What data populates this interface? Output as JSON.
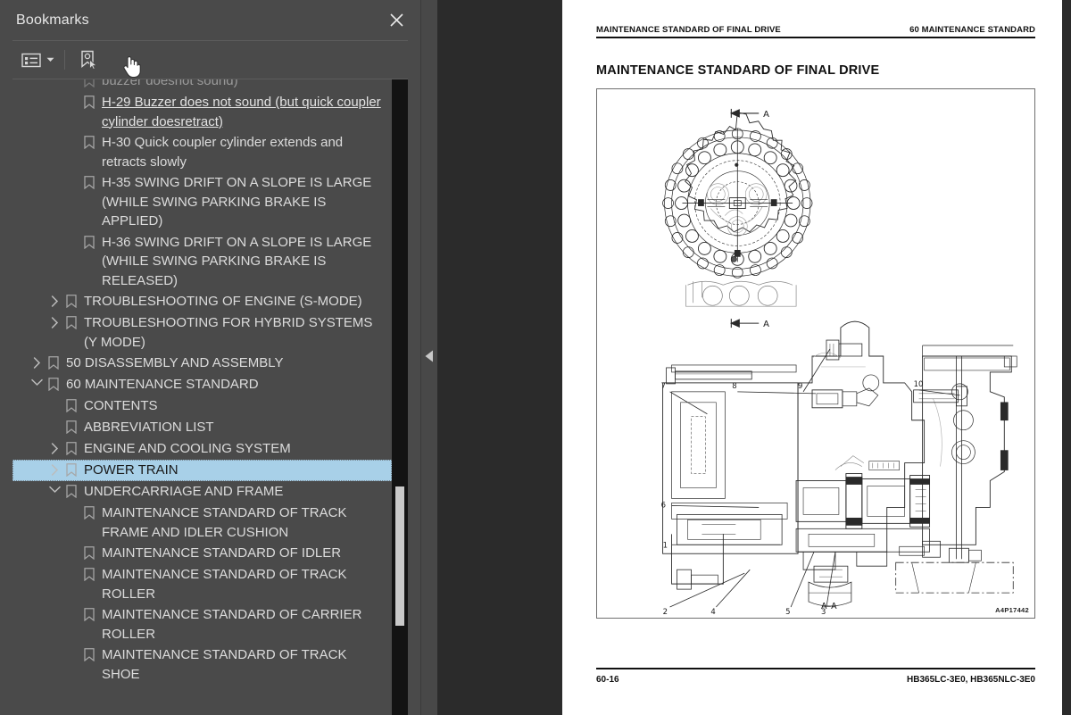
{
  "panel": {
    "title": "Bookmarks",
    "close_icon": "close-icon",
    "toolbar": {
      "options_icon": "list-options-icon",
      "caret_icon": "chevron-down-icon",
      "new_bookmark_icon": "new-bookmark-icon"
    },
    "cursor_icon": "pointing-hand-cursor"
  },
  "bookmarks": [
    {
      "level": 3,
      "label": "buzzer doesnot sound)",
      "state": "partial",
      "chevron": "none",
      "clipped": true
    },
    {
      "level": 3,
      "label": " H-29 Buzzer does not sound (but quick coupler cylinder doesretract)",
      "state": "visited",
      "chevron": "none"
    },
    {
      "level": 3,
      "label": " H-30 Quick coupler cylinder extends and retracts slowly",
      "state": "normal",
      "chevron": "none"
    },
    {
      "level": 3,
      "label": " H-35 SWING DRIFT ON A SLOPE IS LARGE (WHILE SWING PARKING BRAKE IS APPLIED)",
      "state": "normal",
      "chevron": "none"
    },
    {
      "level": 3,
      "label": " H-36 SWING DRIFT ON A SLOPE IS LARGE (WHILE SWING PARKING BRAKE IS RELEASED)",
      "state": "normal",
      "chevron": "none"
    },
    {
      "level": 2,
      "label": "TROUBLESHOOTING OF ENGINE (S-MODE)",
      "state": "normal",
      "chevron": "collapsed"
    },
    {
      "level": 2,
      "label": "TROUBLESHOOTING FOR HYBRID SYSTEMS (Y MODE)",
      "state": "normal",
      "chevron": "collapsed"
    },
    {
      "level": 1,
      "label": "50 DISASSEMBLY AND ASSEMBLY",
      "state": "normal",
      "chevron": "collapsed"
    },
    {
      "level": 1,
      "label": "60 MAINTENANCE STANDARD",
      "state": "normal",
      "chevron": "expanded"
    },
    {
      "level": 2,
      "label": "CONTENTS",
      "state": "normal",
      "chevron": "none"
    },
    {
      "level": 2,
      "label": "ABBREVIATION LIST",
      "state": "normal",
      "chevron": "none"
    },
    {
      "level": 2,
      "label": "ENGINE AND COOLING SYSTEM",
      "state": "normal",
      "chevron": "collapsed"
    },
    {
      "level": 2,
      "label": "POWER TRAIN",
      "state": "selected",
      "chevron": "collapsed"
    },
    {
      "level": 2,
      "label": "UNDERCARRIAGE AND FRAME",
      "state": "normal",
      "chevron": "expanded"
    },
    {
      "level": 3,
      "label": "MAINTENANCE STANDARD OF TRACK FRAME AND IDLER CUSHION",
      "state": "normal",
      "chevron": "none"
    },
    {
      "level": 3,
      "label": "MAINTENANCE STANDARD OF IDLER",
      "state": "normal",
      "chevron": "none"
    },
    {
      "level": 3,
      "label": "MAINTENANCE STANDARD OF TRACK ROLLER",
      "state": "normal",
      "chevron": "none"
    },
    {
      "level": 3,
      "label": "MAINTENANCE STANDARD OF CARRIER ROLLER",
      "state": "normal",
      "chevron": "none"
    },
    {
      "level": 3,
      "label": "MAINTENANCE STANDARD OF TRACK SHOE",
      "state": "normal",
      "chevron": "none"
    }
  ],
  "splitter": {
    "collapse_icon": "collapse-left-arrow"
  },
  "document": {
    "header_left": "MAINTENANCE STANDARD OF FINAL DRIVE",
    "header_right": "60 MAINTENANCE STANDARD",
    "section_title": "MAINTENANCE STANDARD OF FINAL DRIVE",
    "figure": {
      "drawing_number": "A4P17442",
      "section_label": "A–A",
      "section_marker_top": "A",
      "section_marker_bottom": "A",
      "callouts": [
        "1",
        "2",
        "3",
        "4",
        "5",
        "6",
        "7",
        "8",
        "9",
        "10"
      ]
    },
    "footer_left": "60-16",
    "footer_right": "HB365LC-3E0, HB365NLC-3E0"
  },
  "colors": {
    "panel_bg": "#4a4a4a",
    "selection": "#a8d0e8",
    "doc_bg": "#2b2b2b",
    "page": "#ffffff",
    "text": "#dcdcdc"
  }
}
